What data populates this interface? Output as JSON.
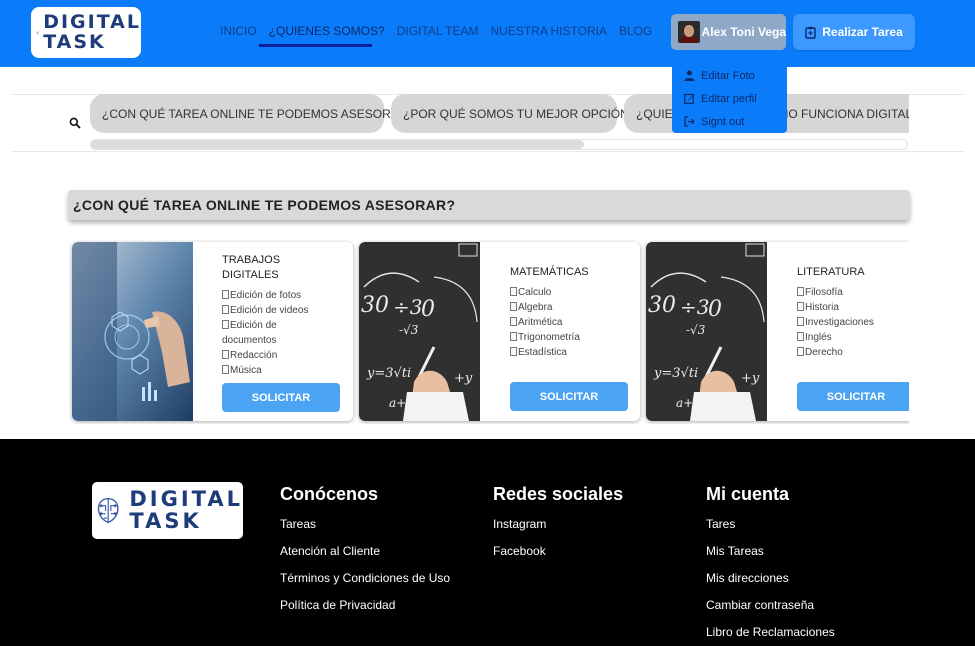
{
  "header": {
    "logo": {
      "line1": "DIGITAL",
      "line2": "TASK"
    },
    "nav": [
      {
        "label": "INICIO"
      },
      {
        "label": "¿QUIENES SOMOS?"
      },
      {
        "label": "DIGITAL TEAM"
      },
      {
        "label": "NUESTRA HISTORIA"
      },
      {
        "label": "BLOG"
      }
    ],
    "active_nav": "¿QUIENES SOMOS?",
    "user_name": "Alex Toni Vega",
    "task_button": "Realizar Tarea",
    "user_menu": [
      {
        "label": "Editar Foto",
        "icon": "person-icon"
      },
      {
        "label": "Editar perfil",
        "icon": "edit-icon"
      },
      {
        "label": "Signt out",
        "icon": "logout-icon"
      }
    ]
  },
  "categories": {
    "chips": [
      "¿CON QUÉ TAREA ONLINE TE PODEMOS ASESORAR?",
      "¿POR QUÉ SOMOS TU MEJOR OPCIÓN?",
      "¿QUIENES SOMOS?",
      "¿CÓMO FUNCIONA DIGITAL TASK?"
    ],
    "scroll_position_fraction": 0.6
  },
  "section_title": "¿CON QUÉ TAREA ONLINE TE PODEMOS ASESORAR?",
  "cards": [
    {
      "title": "TRABAJOS DIGITALES",
      "items": [
        "Edición de fotos",
        "Edición de videos",
        "Edición de documentos",
        "Redacción",
        "Música"
      ],
      "button": "SOLICITAR",
      "image": "digital-hand-image"
    },
    {
      "title": "MATEMÁTICAS",
      "items": [
        "Calculo",
        "Algebra",
        "Aritmética",
        "Trigonometría",
        "Estadística"
      ],
      "button": "SOLICITAR",
      "image": "chalkboard-math-image"
    },
    {
      "title": "LITERATURA",
      "items": [
        "Filosofía",
        "Historia",
        "Investigaciones",
        "Inglés",
        "Derecho"
      ],
      "button": "SOLICITAR",
      "image": "chalkboard-math-image"
    }
  ],
  "footer": {
    "logo": {
      "line1": "DIGITAL",
      "line2": "TASK"
    },
    "columns": [
      {
        "heading": "Conócenos",
        "links": [
          "Tareas",
          "Atención al Cliente",
          "Términos y Condiciones de Uso",
          "Política de Privacidad"
        ]
      },
      {
        "heading": "Redes sociales",
        "links": [
          "Instagram",
          "Facebook"
        ]
      },
      {
        "heading": "Mi cuenta",
        "links": [
          "Tares",
          "Mis Tareas",
          "Mis direcciones",
          "Cambiar contraseña",
          "Libro de Reclamaciones"
        ]
      }
    ]
  },
  "colors": {
    "header_bg": "#0a7cf9",
    "button_blue": "#4aa3f3",
    "footer_bg": "#000000",
    "chip_bg": "#d6d6d6"
  }
}
